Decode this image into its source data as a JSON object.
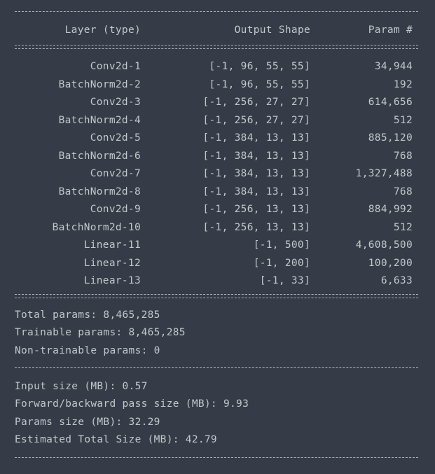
{
  "header": {
    "layer": "Layer (type)",
    "shape": "Output Shape",
    "param": "Param #"
  },
  "rows": [
    {
      "layer": "Conv2d-1",
      "shape": "[-1, 96, 55, 55]",
      "param": "34,944"
    },
    {
      "layer": "BatchNorm2d-2",
      "shape": "[-1, 96, 55, 55]",
      "param": "192"
    },
    {
      "layer": "Conv2d-3",
      "shape": "[-1, 256, 27, 27]",
      "param": "614,656"
    },
    {
      "layer": "BatchNorm2d-4",
      "shape": "[-1, 256, 27, 27]",
      "param": "512"
    },
    {
      "layer": "Conv2d-5",
      "shape": "[-1, 384, 13, 13]",
      "param": "885,120"
    },
    {
      "layer": "BatchNorm2d-6",
      "shape": "[-1, 384, 13, 13]",
      "param": "768"
    },
    {
      "layer": "Conv2d-7",
      "shape": "[-1, 384, 13, 13]",
      "param": "1,327,488"
    },
    {
      "layer": "BatchNorm2d-8",
      "shape": "[-1, 384, 13, 13]",
      "param": "768"
    },
    {
      "layer": "Conv2d-9",
      "shape": "[-1, 256, 13, 13]",
      "param": "884,992"
    },
    {
      "layer": "BatchNorm2d-10",
      "shape": "[-1, 256, 13, 13]",
      "param": "512"
    },
    {
      "layer": "Linear-11",
      "shape": "[-1, 500]",
      "param": "4,608,500"
    },
    {
      "layer": "Linear-12",
      "shape": "[-1, 200]",
      "param": "100,200"
    },
    {
      "layer": "Linear-13",
      "shape": "[-1, 33]",
      "param": "6,633"
    }
  ],
  "params_summary": {
    "total": "Total params: 8,465,285",
    "trainable": "Trainable params: 8,465,285",
    "non_trainable": "Non-trainable params: 0"
  },
  "size_summary": {
    "input": "Input size (MB): 0.57",
    "forward_backward": "Forward/backward pass size (MB): 9.93",
    "params": "Params size (MB): 32.29",
    "total": "Estimated Total Size (MB): 42.79"
  },
  "colors": {
    "background": "#353c47",
    "text": "#c3c7cc"
  }
}
